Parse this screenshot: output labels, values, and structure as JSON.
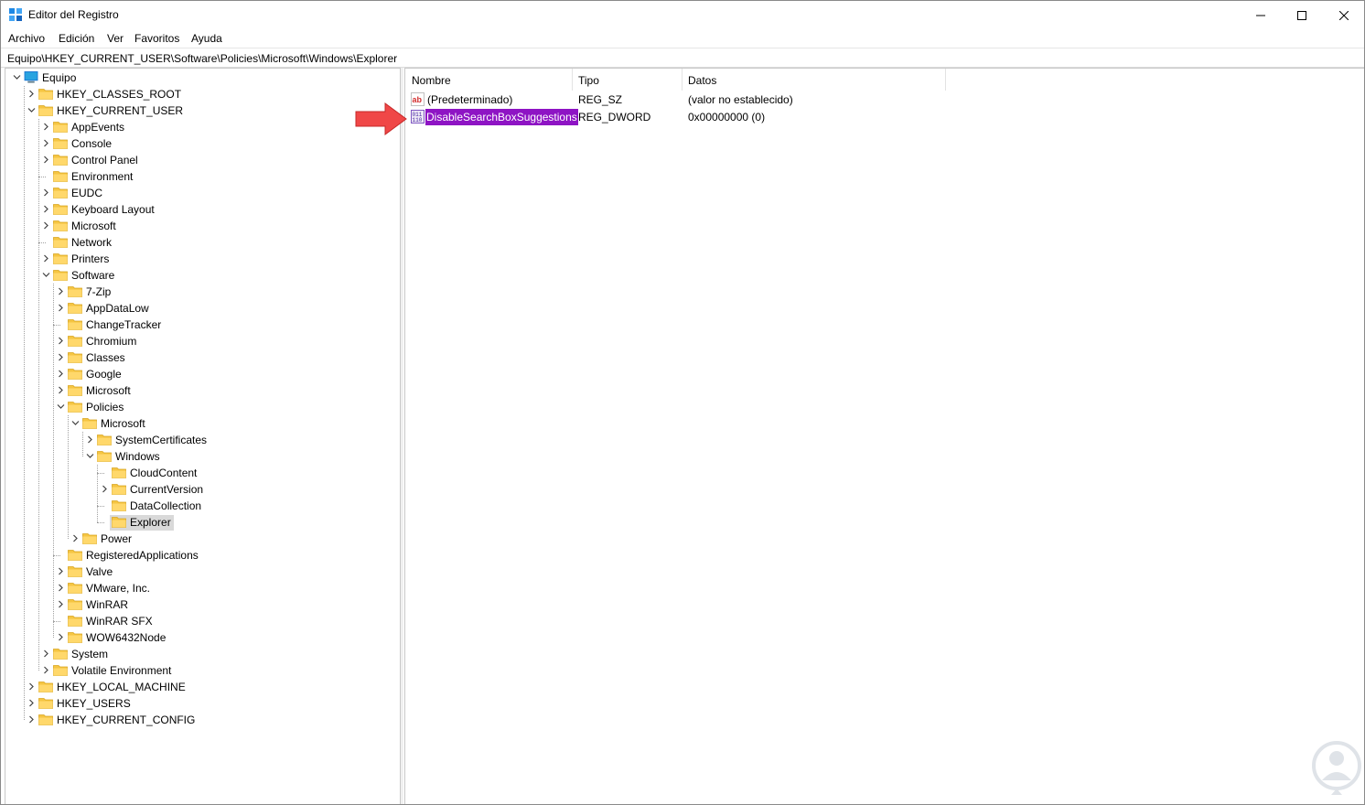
{
  "window": {
    "title": "Editor del Registro",
    "controls": [
      "minimize",
      "maximize",
      "close"
    ]
  },
  "menu": [
    "Archivo",
    "Edición",
    "Ver",
    "Favoritos",
    "Ayuda"
  ],
  "address": "Equipo\\HKEY_CURRENT_USER\\Software\\Policies\\Microsoft\\Windows\\Explorer",
  "tree": [
    {
      "label": "Equipo",
      "depth": 0,
      "expander": "expanded",
      "icon": "computer-icon"
    },
    {
      "label": "HKEY_CLASSES_ROOT",
      "depth": 1,
      "expander": "collapsed"
    },
    {
      "label": "HKEY_CURRENT_USER",
      "depth": 1,
      "expander": "expanded"
    },
    {
      "label": "AppEvents",
      "depth": 2,
      "expander": "collapsed"
    },
    {
      "label": "Console",
      "depth": 2,
      "expander": "collapsed"
    },
    {
      "label": "Control Panel",
      "depth": 2,
      "expander": "collapsed"
    },
    {
      "label": "Environment",
      "depth": 2,
      "expander": "none"
    },
    {
      "label": "EUDC",
      "depth": 2,
      "expander": "collapsed"
    },
    {
      "label": "Keyboard Layout",
      "depth": 2,
      "expander": "collapsed"
    },
    {
      "label": "Microsoft",
      "depth": 2,
      "expander": "collapsed"
    },
    {
      "label": "Network",
      "depth": 2,
      "expander": "none"
    },
    {
      "label": "Printers",
      "depth": 2,
      "expander": "collapsed"
    },
    {
      "label": "Software",
      "depth": 2,
      "expander": "expanded"
    },
    {
      "label": "7-Zip",
      "depth": 3,
      "expander": "collapsed"
    },
    {
      "label": "AppDataLow",
      "depth": 3,
      "expander": "collapsed"
    },
    {
      "label": "ChangeTracker",
      "depth": 3,
      "expander": "none"
    },
    {
      "label": "Chromium",
      "depth": 3,
      "expander": "collapsed"
    },
    {
      "label": "Classes",
      "depth": 3,
      "expander": "collapsed"
    },
    {
      "label": "Google",
      "depth": 3,
      "expander": "collapsed"
    },
    {
      "label": "Microsoft",
      "depth": 3,
      "expander": "collapsed"
    },
    {
      "label": "Policies",
      "depth": 3,
      "expander": "expanded"
    },
    {
      "label": "Microsoft",
      "depth": 4,
      "expander": "expanded"
    },
    {
      "label": "SystemCertificates",
      "depth": 5,
      "expander": "collapsed"
    },
    {
      "label": "Windows",
      "depth": 5,
      "expander": "expanded"
    },
    {
      "label": "CloudContent",
      "depth": 6,
      "expander": "none"
    },
    {
      "label": "CurrentVersion",
      "depth": 6,
      "expander": "collapsed"
    },
    {
      "label": "DataCollection",
      "depth": 6,
      "expander": "none"
    },
    {
      "label": "Explorer",
      "depth": 6,
      "expander": "none",
      "selected": true
    },
    {
      "label": "Power",
      "depth": 4,
      "expander": "collapsed"
    },
    {
      "label": "RegisteredApplications",
      "depth": 3,
      "expander": "none"
    },
    {
      "label": "Valve",
      "depth": 3,
      "expander": "collapsed"
    },
    {
      "label": "VMware, Inc.",
      "depth": 3,
      "expander": "collapsed"
    },
    {
      "label": "WinRAR",
      "depth": 3,
      "expander": "collapsed"
    },
    {
      "label": "WinRAR SFX",
      "depth": 3,
      "expander": "none"
    },
    {
      "label": "WOW6432Node",
      "depth": 3,
      "expander": "collapsed"
    },
    {
      "label": "System",
      "depth": 2,
      "expander": "collapsed"
    },
    {
      "label": "Volatile Environment",
      "depth": 2,
      "expander": "collapsed"
    },
    {
      "label": "HKEY_LOCAL_MACHINE",
      "depth": 1,
      "expander": "collapsed"
    },
    {
      "label": "HKEY_USERS",
      "depth": 1,
      "expander": "collapsed"
    },
    {
      "label": "HKEY_CURRENT_CONFIG",
      "depth": 1,
      "expander": "collapsed"
    }
  ],
  "list": {
    "columns": [
      "Nombre",
      "Tipo",
      "Datos"
    ],
    "rows": [
      {
        "name": "(Predeterminado)",
        "type": "REG_SZ",
        "data": "(valor no establecido)",
        "icon": "string-value-icon"
      },
      {
        "name": "DisableSearchBoxSuggestions",
        "type": "REG_DWORD",
        "data": "0x00000000 (0)",
        "icon": "binary-value-icon",
        "selected": true
      }
    ]
  },
  "colors": {
    "selection": "#8e14c4",
    "tree_selection": "#d9d9d9",
    "folder": "#f5c542",
    "arrow": "#f04747"
  }
}
